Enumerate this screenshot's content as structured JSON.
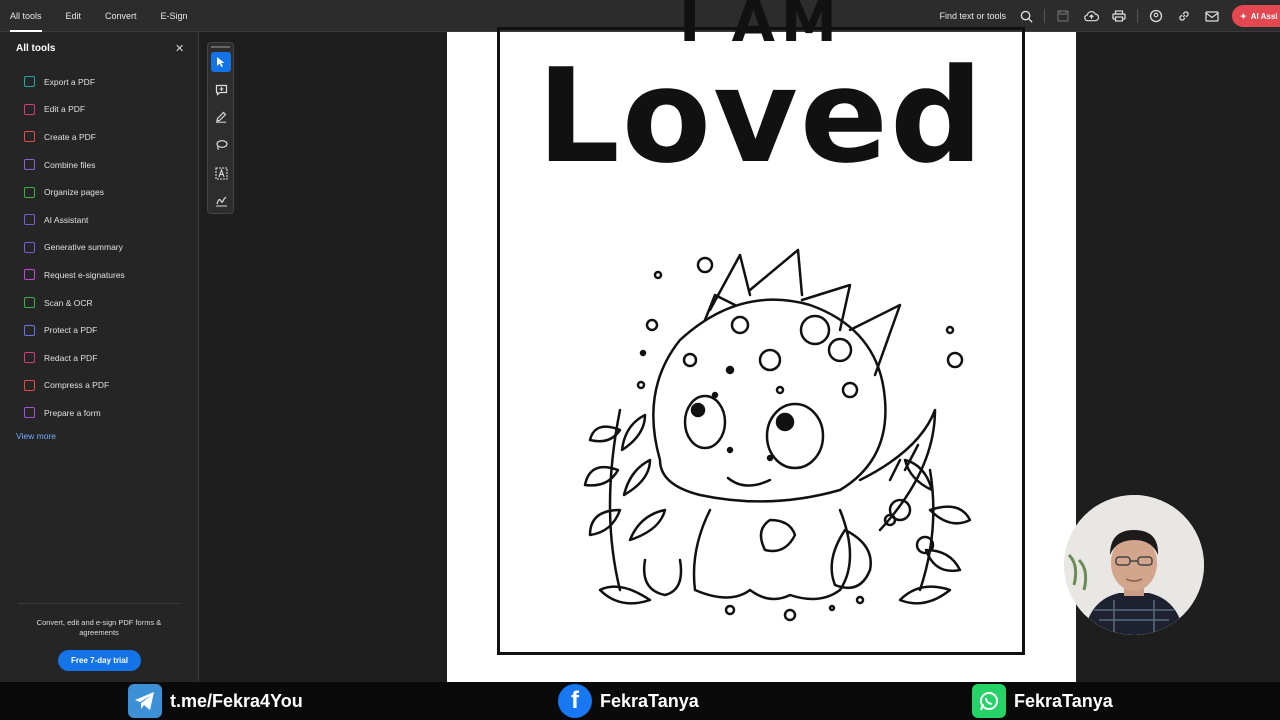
{
  "menu": [
    "All tools",
    "Edit",
    "Convert",
    "E-Sign"
  ],
  "topbar": {
    "find_label": "Find text or tools",
    "ai_label": "AI Assi"
  },
  "sidebar": {
    "title": "All tools",
    "items": [
      {
        "label": "Export a PDF",
        "color": "#22a89f"
      },
      {
        "label": "Edit a PDF",
        "color": "#d33b7a"
      },
      {
        "label": "Create a PDF",
        "color": "#e14b4b"
      },
      {
        "label": "Combine files",
        "color": "#8a63d2"
      },
      {
        "label": "Organize pages",
        "color": "#3fae49"
      },
      {
        "label": "AI Assistant",
        "color": "#7b5cd6"
      },
      {
        "label": "Generative summary",
        "color": "#7b5cd6"
      },
      {
        "label": "Request e-signatures",
        "color": "#c34ad6"
      },
      {
        "label": "Scan & OCR",
        "color": "#3fae49"
      },
      {
        "label": "Protect a PDF",
        "color": "#6d74e0"
      },
      {
        "label": "Redact a PDF",
        "color": "#d33b7a"
      },
      {
        "label": "Compress a PDF",
        "color": "#e14b4b"
      },
      {
        "label": "Prepare a form",
        "color": "#a354d6"
      }
    ],
    "view_more": "View more",
    "promo": "Convert, edit and e-sign PDF forms & agreements",
    "trial_button": "Free 7-day trial"
  },
  "document": {
    "heading_top": "I AM",
    "heading_main": "Loved"
  },
  "footer": {
    "telegram": "t.me/Fekra4You",
    "facebook": "FekraTanya",
    "whatsapp": "FekraTanya"
  }
}
